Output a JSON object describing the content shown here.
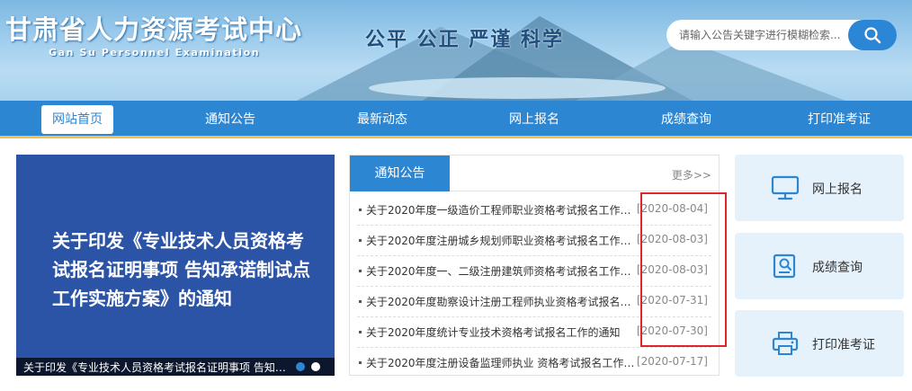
{
  "header": {
    "site_title": "甘肃省人力资源考试中心",
    "site_title_en": "Gan Su Personnel Examination",
    "slogan": "公平 公正 严谨 科学",
    "search_placeholder": "请输入公告关键字进行模糊检索..."
  },
  "nav": {
    "items": [
      {
        "label": "网站首页",
        "active": true
      },
      {
        "label": "通知公告"
      },
      {
        "label": "最新动态"
      },
      {
        "label": "网上报名"
      },
      {
        "label": "成绩查询"
      },
      {
        "label": "打印准考证"
      }
    ]
  },
  "slider": {
    "headline": "关于印发《专业技术人员资格考试报名证明事项 告知承诺制试点工作实施方案》的通知",
    "caption": "关于印发《专业技术人员资格考试报名证明事项 告知承诺制试点工作实施方案》的通知",
    "dots": 2,
    "active_dot": 1
  },
  "notice": {
    "tab_label": "通知公告",
    "more_label": "更多>>",
    "items": [
      {
        "title": "关于2020年度一级造价工程师职业资格考试报名工作的...",
        "date": "[2020-08-04]"
      },
      {
        "title": "关于2020年度注册城乡规划师职业资格考试报名工作的...",
        "date": "[2020-08-03]"
      },
      {
        "title": "关于2020年度一、二级注册建筑师资格考试报名工作的...",
        "date": "[2020-08-03]"
      },
      {
        "title": "关于2020年度勘察设计注册工程师执业资格考试报名工...",
        "date": "[2020-07-31]"
      },
      {
        "title": "关于2020年度统计专业技术资格考试报名工作的通知",
        "date": "[2020-07-30]"
      },
      {
        "title": "关于2020年度注册设备监理师执业 资格考试报名工作的...",
        "date": "[2020-07-17]"
      }
    ]
  },
  "quick_links": [
    {
      "label": "网上报名",
      "icon": "monitor-icon"
    },
    {
      "label": "成绩查询",
      "icon": "search-document-icon"
    },
    {
      "label": "打印准考证",
      "icon": "printer-icon"
    }
  ],
  "colors": {
    "nav_blue": "#2d86d2",
    "slider_blue": "#2b54a7",
    "quick_bg": "#e5f1fb",
    "highlight_red": "#e0262b",
    "accent_yellow": "#f3c24b"
  }
}
